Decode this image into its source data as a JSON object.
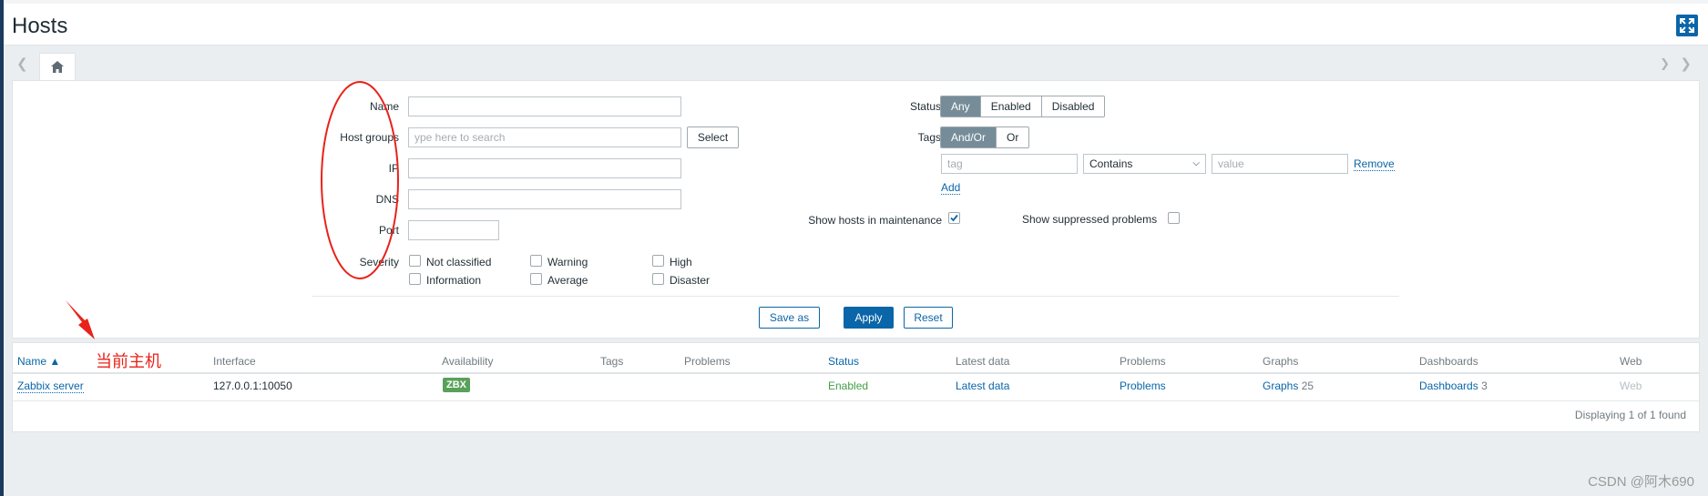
{
  "page": {
    "title": "Hosts"
  },
  "filter": {
    "name_label": "Name",
    "hostgroups_label": "Host groups",
    "hostgroups_placeholder": "ype here to search",
    "select_label": "Select",
    "ip_label": "IP",
    "dns_label": "DNS",
    "port_label": "Port",
    "severity_label": "Severity",
    "severities": [
      "Not classified",
      "Warning",
      "High",
      "Information",
      "Average",
      "Disaster"
    ],
    "status_label": "Status",
    "status_options": [
      "Any",
      "Enabled",
      "Disabled"
    ],
    "status_selected": "Any",
    "tags_label": "Tags",
    "tags_options": [
      "And/Or",
      "Or"
    ],
    "tags_selected": "And/Or",
    "tag_placeholder": "tag",
    "tag_operator": "Contains",
    "value_placeholder": "value",
    "remove_label": "Remove",
    "add_label": "Add",
    "maintenance_label": "Show hosts in maintenance",
    "maintenance_checked": true,
    "suppressed_label": "Show suppressed problems",
    "suppressed_checked": false,
    "save_as_label": "Save as",
    "apply_label": "Apply",
    "reset_label": "Reset"
  },
  "table": {
    "columns": [
      "Name ▲",
      "Interface",
      "Availability",
      "Tags",
      "Problems",
      "Status",
      "Latest data",
      "Problems",
      "Graphs",
      "Dashboards",
      "Web"
    ],
    "rows": [
      {
        "name": "Zabbix server",
        "interface": "127.0.0.1:10050",
        "availability": "ZBX",
        "tags": "",
        "problems": "",
        "status": "Enabled",
        "latest_data": "Latest data",
        "problems_link": "Problems",
        "graphs": "Graphs",
        "graphs_count": "25",
        "dashboards": "Dashboards",
        "dashboards_count": "3",
        "web": "Web"
      }
    ],
    "footer": "Displaying 1 of 1 found"
  },
  "annotation": {
    "text": "当前主机",
    "color": "#e8231a"
  },
  "watermark": "CSDN @阿木690",
  "colors": {
    "accent": "#0a66a8",
    "enabled": "#429e47",
    "zbx_badge": "#59a15a",
    "annotation": "#e8231a"
  }
}
